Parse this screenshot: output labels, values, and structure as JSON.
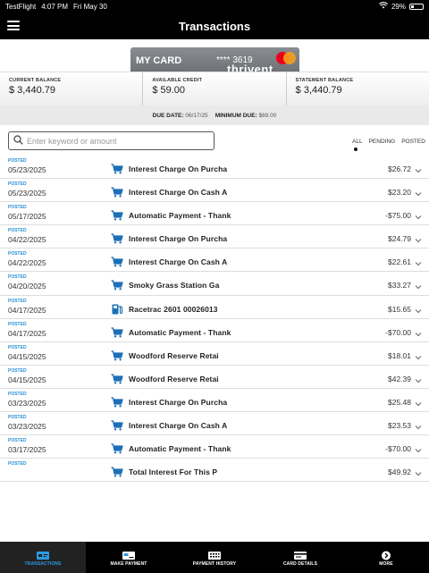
{
  "status_bar": {
    "app": "TestFlight",
    "time": "4:07 PM",
    "date": "Fri May 30",
    "battery": "29%",
    "battery_level": 0.29
  },
  "header": {
    "title": "Transactions"
  },
  "card": {
    "name": "MY CARD",
    "number": "**** 3619",
    "brand": "thrivent"
  },
  "balances": [
    {
      "label": "CURRENT BALANCE",
      "value": "$ 3,440.79"
    },
    {
      "label": "AVAILABLE CREDIT",
      "value": "$ 59.00"
    },
    {
      "label": "STATEMENT BALANCE",
      "value": "$ 3,440.79"
    }
  ],
  "due": {
    "due_label": "DUE DATE:",
    "due_date": "06/17/25",
    "min_label": "MINIMUM DUE:",
    "min_due": "$69.00"
  },
  "search": {
    "placeholder": "Enter keyword or amount"
  },
  "filters": {
    "all": "ALL",
    "pending": "PENDING",
    "posted": "POSTED",
    "selected": "ALL"
  },
  "transactions": [
    {
      "status": "POSTED",
      "date": "05/23/2025",
      "description": "Interest Charge On Purcha",
      "amount": "$26.72",
      "icon": "cart-icon"
    },
    {
      "status": "POSTED",
      "date": "05/23/2025",
      "description": "Interest Charge On Cash A",
      "amount": "$23.20",
      "icon": "cart-icon"
    },
    {
      "status": "POSTED",
      "date": "05/17/2025",
      "description": "Automatic Payment - Thank",
      "amount": "-$75.00",
      "icon": "cart-icon"
    },
    {
      "status": "POSTED",
      "date": "04/22/2025",
      "description": "Interest Charge On Purcha",
      "amount": "$24.79",
      "icon": "cart-icon"
    },
    {
      "status": "POSTED",
      "date": "04/22/2025",
      "description": "Interest Charge On Cash A",
      "amount": "$22.61",
      "icon": "cart-icon"
    },
    {
      "status": "POSTED",
      "date": "04/20/2025",
      "description": "Smoky Grass Station Ga",
      "amount": "$33.27",
      "icon": "cart-icon"
    },
    {
      "status": "POSTED",
      "date": "04/17/2025",
      "description": "Racetrac 2601 00026013",
      "amount": "$15.65",
      "icon": "fuel-pump-icon"
    },
    {
      "status": "POSTED",
      "date": "04/17/2025",
      "description": "Automatic Payment - Thank",
      "amount": "-$70.00",
      "icon": "cart-icon"
    },
    {
      "status": "POSTED",
      "date": "04/15/2025",
      "description": "Woodford Reserve Retai",
      "amount": "$18.01",
      "icon": "cart-icon"
    },
    {
      "status": "POSTED",
      "date": "04/15/2025",
      "description": "Woodford Reserve Retai",
      "amount": "$42.39",
      "icon": "cart-icon"
    },
    {
      "status": "POSTED",
      "date": "03/23/2025",
      "description": "Interest Charge On Purcha",
      "amount": "$25.48",
      "icon": "cart-icon"
    },
    {
      "status": "POSTED",
      "date": "03/23/2025",
      "description": "Interest Charge On Cash A",
      "amount": "$23.53",
      "icon": "cart-icon"
    },
    {
      "status": "POSTED",
      "date": "03/17/2025",
      "description": "Automatic Payment - Thank",
      "amount": "-$70.00",
      "icon": "cart-icon"
    },
    {
      "status": "POSTED",
      "date": "",
      "description": "Total Interest For This P",
      "amount": "$49.92",
      "icon": "cart-icon"
    }
  ],
  "tabs": [
    {
      "label": "TRANSACTIONS",
      "icon": "transactions-icon",
      "active": true
    },
    {
      "label": "MAKE PAYMENT",
      "icon": "make-payment-icon",
      "active": false
    },
    {
      "label": "PAYMENT HISTORY",
      "icon": "payment-history-icon",
      "active": false
    },
    {
      "label": "CARD DETAILS",
      "icon": "card-details-icon",
      "active": false
    },
    {
      "label": "MORE",
      "icon": "more-icon",
      "active": false
    }
  ],
  "colors": {
    "accent": "#2a9be6",
    "posted": "#2a8fd6",
    "header_bg": "#000000"
  }
}
